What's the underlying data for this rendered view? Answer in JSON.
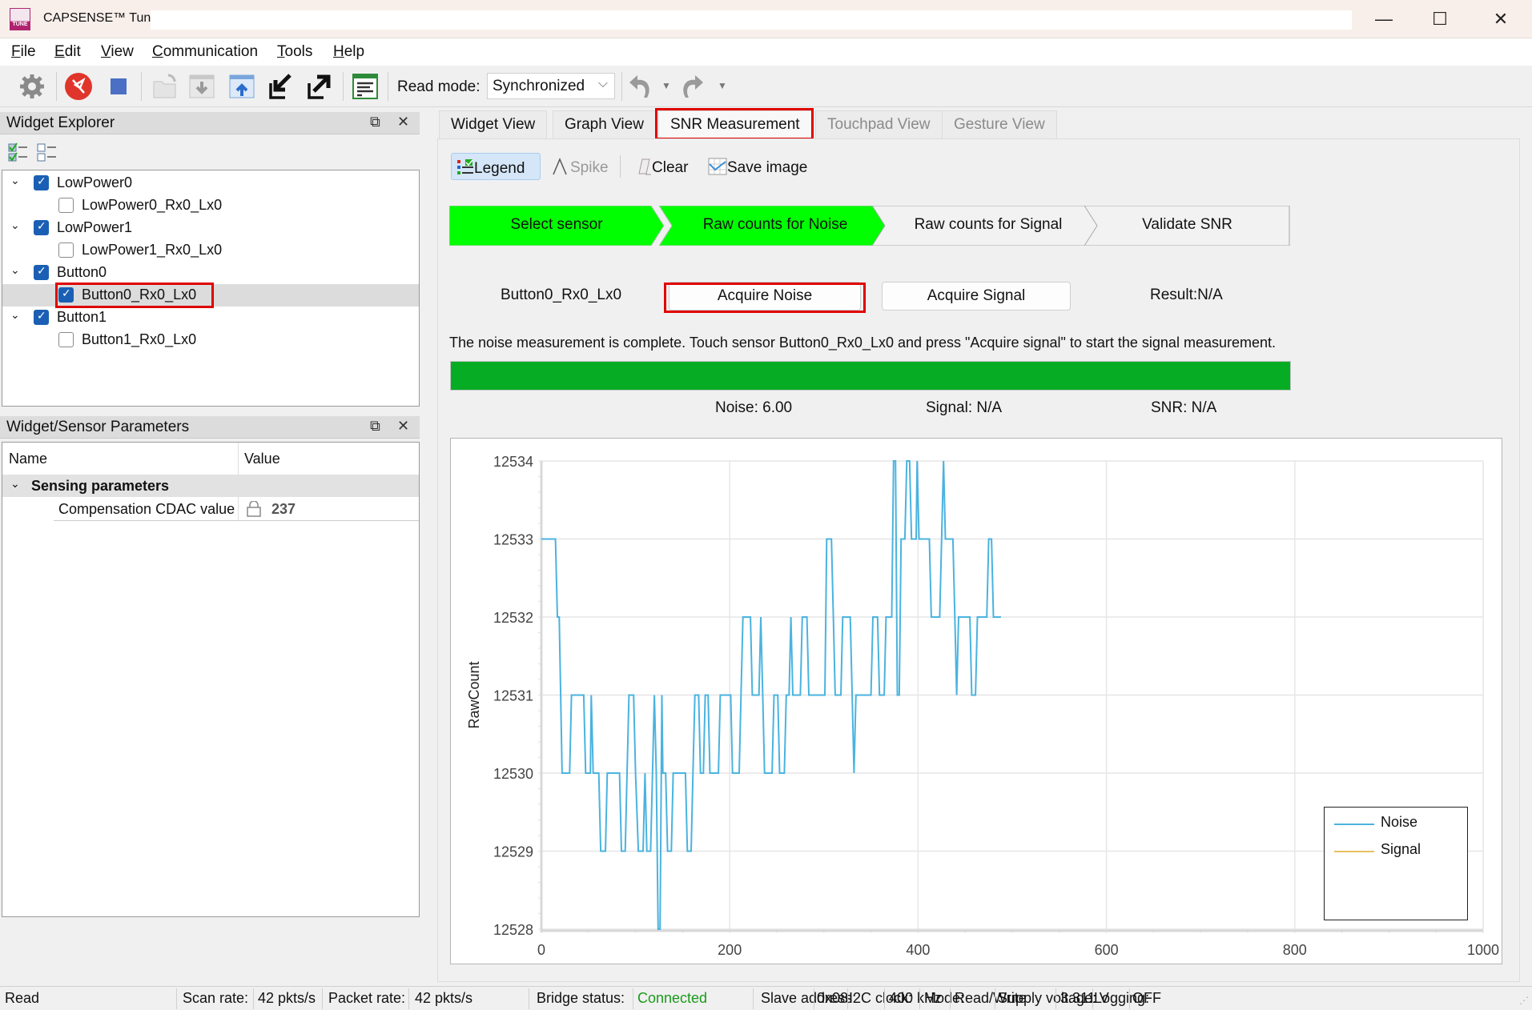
{
  "window": {
    "title": "CAPSENSE™ Tuner",
    "app_icon_label": "TUNE",
    "minimize": "—",
    "maximize": "☐",
    "close": "✕"
  },
  "menu": [
    {
      "label": "File",
      "accel": "F",
      "rest": "ile"
    },
    {
      "label": "Edit",
      "accel": "E",
      "rest": "dit"
    },
    {
      "label": "View",
      "accel": "V",
      "rest": "iew"
    },
    {
      "label": "Communication",
      "accel": "C",
      "rest": "ommunication"
    },
    {
      "label": "Tools",
      "accel": "T",
      "rest": "ools"
    },
    {
      "label": "Help",
      "accel": "H",
      "rest": "elp"
    }
  ],
  "toolbar": {
    "icons": [
      "gear-icon",
      "disconnect-icon",
      "stop-icon",
      "open-icon",
      "import-icon",
      "export-icon",
      "read-from-device-icon",
      "write-to-device-icon",
      "log-icon",
      "undo-icon",
      "redo-icon"
    ],
    "read_mode_label": "Read mode:",
    "read_mode_value": "Synchronized"
  },
  "widget_explorer": {
    "title": "Widget Explorer",
    "tree": [
      {
        "label": "LowPower0",
        "level": 0,
        "checked": true,
        "expanded": true
      },
      {
        "label": "LowPower0_Rx0_Lx0",
        "level": 1,
        "checked": false
      },
      {
        "label": "LowPower1",
        "level": 0,
        "checked": true,
        "expanded": true
      },
      {
        "label": "LowPower1_Rx0_Lx0",
        "level": 1,
        "checked": false
      },
      {
        "label": "Button0",
        "level": 0,
        "checked": true,
        "expanded": true
      },
      {
        "label": "Button0_Rx0_Lx0",
        "level": 1,
        "checked": true,
        "selected": true
      },
      {
        "label": "Button1",
        "level": 0,
        "checked": true,
        "expanded": true
      },
      {
        "label": "Button1_Rx0_Lx0",
        "level": 1,
        "checked": false
      }
    ]
  },
  "parameters": {
    "title": "Widget/Sensor Parameters",
    "col_name": "Name",
    "col_value": "Value",
    "group": "Sensing parameters",
    "rows": [
      {
        "name": "Compensation CDAC value",
        "value": "237",
        "locked": true
      }
    ]
  },
  "tabs": [
    {
      "label": "Widget View",
      "state": "normal"
    },
    {
      "label": "Graph View",
      "state": "normal"
    },
    {
      "label": "SNR Measurement",
      "state": "active"
    },
    {
      "label": "Touchpad View",
      "state": "disabled"
    },
    {
      "label": "Gesture View",
      "state": "disabled"
    }
  ],
  "snr_toolbar": {
    "legend": "Legend",
    "spike": "Spike",
    "clear": "Clear",
    "save_image": "Save image"
  },
  "steps": [
    {
      "label": "Select sensor",
      "done": true
    },
    {
      "label": "Raw counts for Noise",
      "done": true
    },
    {
      "label": "Raw counts for Signal",
      "done": false
    },
    {
      "label": "Validate SNR",
      "done": false
    }
  ],
  "snr": {
    "sensor": "Button0_Rx0_Lx0",
    "acquire_noise": "Acquire Noise",
    "acquire_signal": "Acquire Signal",
    "result": "Result:N/A",
    "message": "The noise measurement is complete. Touch sensor Button0_Rx0_Lx0 and press \"Acquire signal\" to start the signal measurement.",
    "progress_percent": 100,
    "noise": "Noise:  6.00",
    "signal": "Signal:  N/A",
    "snr": "SNR:  N/A"
  },
  "colors": {
    "step_done": "#00ff00",
    "progress": "#06ad24",
    "noise_line": "#4ab3df",
    "signal_line": "#e8c060",
    "highlight": "#e00000",
    "connected": "#1a9a1a"
  },
  "chart_data": {
    "type": "line",
    "title": "",
    "xlabel": "",
    "ylabel": "RawCount",
    "xlim": [
      0,
      1000
    ],
    "ylim": [
      12528,
      12534
    ],
    "xticks": [
      "0",
      "200",
      "400",
      "600",
      "800",
      "1000"
    ],
    "yticks": [
      "12528",
      "12529",
      "12530",
      "12531",
      "12532",
      "12533",
      "12534"
    ],
    "grid": true,
    "legend_position": "bottom-right",
    "series": [
      {
        "name": "Noise",
        "step": true,
        "points": [
          [
            0,
            12533
          ],
          [
            15,
            12533
          ],
          [
            17,
            12532
          ],
          [
            19,
            12532
          ],
          [
            22,
            12530
          ],
          [
            30,
            12530
          ],
          [
            32,
            12531
          ],
          [
            45,
            12531
          ],
          [
            47,
            12530
          ],
          [
            52,
            12530
          ],
          [
            53,
            12531
          ],
          [
            55,
            12530
          ],
          [
            61,
            12530
          ],
          [
            63,
            12529
          ],
          [
            68,
            12529
          ],
          [
            70,
            12530
          ],
          [
            83,
            12530
          ],
          [
            85,
            12529
          ],
          [
            89,
            12529
          ],
          [
            91,
            12530
          ],
          [
            93,
            12531
          ],
          [
            98,
            12531
          ],
          [
            100,
            12530
          ],
          [
            103,
            12529
          ],
          [
            108,
            12529
          ],
          [
            110,
            12530
          ],
          [
            112,
            12529
          ],
          [
            116,
            12529
          ],
          [
            118,
            12530
          ],
          [
            120,
            12531
          ],
          [
            122,
            12530
          ],
          [
            124,
            12528
          ],
          [
            126,
            12528
          ],
          [
            128,
            12531
          ],
          [
            129,
            12530
          ],
          [
            132,
            12530
          ],
          [
            134,
            12529
          ],
          [
            138,
            12529
          ],
          [
            140,
            12530
          ],
          [
            153,
            12530
          ],
          [
            155,
            12529
          ],
          [
            159,
            12529
          ],
          [
            161,
            12530
          ],
          [
            163,
            12531
          ],
          [
            167,
            12531
          ],
          [
            169,
            12530
          ],
          [
            172,
            12530
          ],
          [
            174,
            12531
          ],
          [
            177,
            12531
          ],
          [
            179,
            12530
          ],
          [
            188,
            12530
          ],
          [
            190,
            12531
          ],
          [
            201,
            12531
          ],
          [
            203,
            12530
          ],
          [
            210,
            12530
          ],
          [
            212,
            12531
          ],
          [
            214,
            12532
          ],
          [
            222,
            12532
          ],
          [
            224,
            12531
          ],
          [
            231,
            12531
          ],
          [
            233,
            12532
          ],
          [
            235,
            12531
          ],
          [
            237,
            12530
          ],
          [
            245,
            12530
          ],
          [
            247,
            12531
          ],
          [
            251,
            12531
          ],
          [
            253,
            12530
          ],
          [
            258,
            12530
          ],
          [
            260,
            12531
          ],
          [
            263,
            12531
          ],
          [
            265,
            12532
          ],
          [
            267,
            12531
          ],
          [
            275,
            12531
          ],
          [
            277,
            12532
          ],
          [
            282,
            12532
          ],
          [
            284,
            12531
          ],
          [
            301,
            12531
          ],
          [
            303,
            12533
          ],
          [
            308,
            12533
          ],
          [
            310,
            12532
          ],
          [
            312,
            12531
          ],
          [
            318,
            12531
          ],
          [
            320,
            12532
          ],
          [
            328,
            12532
          ],
          [
            330,
            12531
          ],
          [
            332,
            12530
          ],
          [
            334,
            12531
          ],
          [
            350,
            12531
          ],
          [
            352,
            12532
          ],
          [
            357,
            12532
          ],
          [
            359,
            12531
          ],
          [
            364,
            12531
          ],
          [
            366,
            12532
          ],
          [
            372,
            12532
          ],
          [
            374,
            12534
          ],
          [
            376,
            12534
          ],
          [
            378,
            12531
          ],
          [
            380,
            12531
          ],
          [
            382,
            12533
          ],
          [
            386,
            12533
          ],
          [
            388,
            12534
          ],
          [
            391,
            12534
          ],
          [
            393,
            12533
          ],
          [
            398,
            12533
          ],
          [
            399,
            12534
          ],
          [
            401,
            12533
          ],
          [
            412,
            12533
          ],
          [
            414,
            12532
          ],
          [
            423,
            12532
          ],
          [
            425,
            12533
          ],
          [
            427,
            12534
          ],
          [
            429,
            12533
          ],
          [
            437,
            12533
          ],
          [
            439,
            12532
          ],
          [
            441,
            12531
          ],
          [
            443,
            12532
          ],
          [
            455,
            12532
          ],
          [
            457,
            12531
          ],
          [
            461,
            12531
          ],
          [
            463,
            12532
          ],
          [
            473,
            12532
          ],
          [
            475,
            12533
          ],
          [
            478,
            12533
          ],
          [
            480,
            12532
          ],
          [
            488,
            12532
          ]
        ]
      },
      {
        "name": "Signal",
        "step": true,
        "points": []
      }
    ]
  },
  "statusbar": {
    "mode_text": "Read",
    "scan_rate_label": "Scan rate:",
    "scan_rate": "42 pkts/s",
    "packet_rate_label": "Packet rate:",
    "packet_rate": "42 pkts/s",
    "bridge_label": "Bridge status:",
    "bridge_status": "Connected",
    "slave_label": "Slave address:",
    "slave_address": "0x08",
    "i2c_label": "I2C clock:",
    "i2c_clock": "400 kHz",
    "mode_label": "Mode:",
    "mode": "Read/Write",
    "supply_label": "Supply voltage:",
    "supply_voltage": "3.311 V",
    "logging_label": "Logging:",
    "logging": "OFF"
  }
}
